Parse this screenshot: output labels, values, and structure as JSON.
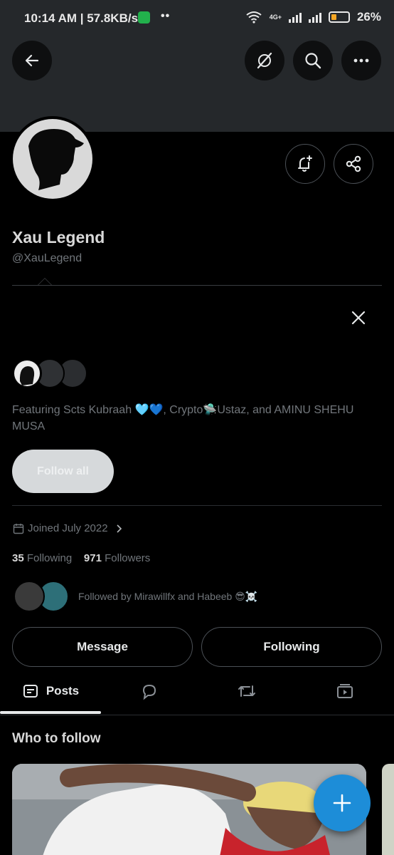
{
  "status_bar": {
    "time_speed": "10:14 AM | 57.8KB/s",
    "dots": "••",
    "network": "4G+",
    "battery": "26%"
  },
  "profile": {
    "name": "Xau Legend",
    "handle": "@XauLegend",
    "joined": "Joined July 2022",
    "following_count": "35",
    "following_label": "Following",
    "followers_count": "971",
    "followers_label": "Followers",
    "followed_by": "Followed by Mirawillfx and Habeeb 😎☠️"
  },
  "suggestion": {
    "featuring": "Featuring Scts Kubraah 🩵💙, Crypto🛸Ustaz, and AMINU SHEHU MUSA",
    "follow_all": "Follow all"
  },
  "actions": {
    "message": "Message",
    "following": "Following"
  },
  "tabs": [
    {
      "label": "Posts",
      "icon": "posts-icon"
    },
    {
      "label": "",
      "icon": "replies-icon"
    },
    {
      "label": "",
      "icon": "reposts-icon"
    },
    {
      "label": "",
      "icon": "media-icon"
    }
  ],
  "who_to_follow": {
    "title": "Who to follow"
  },
  "colors": {
    "accent": "#1d8dd8",
    "banner": "#25282b",
    "muted_text": "#71767b"
  }
}
